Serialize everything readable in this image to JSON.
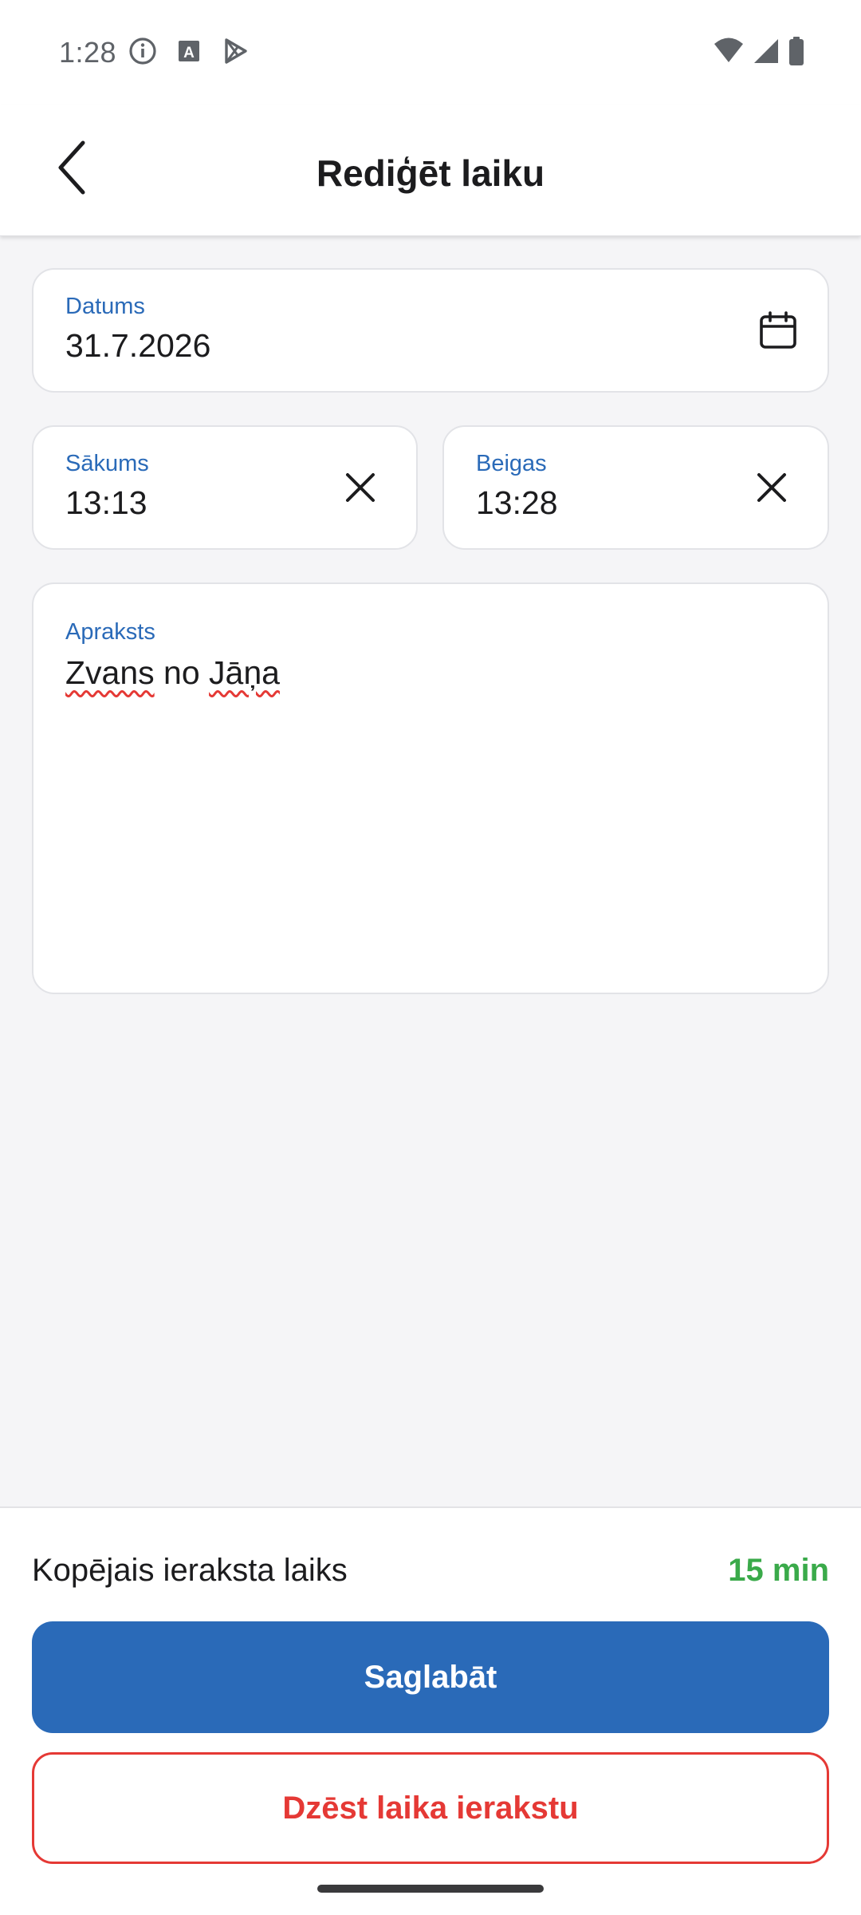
{
  "status_bar": {
    "time": "1:28",
    "left_icons": [
      "info-icon",
      "a-box-icon",
      "play-store-icon"
    ],
    "right_icons": [
      "wifi-icon",
      "signal-icon",
      "battery-icon"
    ]
  },
  "app_bar": {
    "title": "Rediģēt laiku",
    "back_icon": "chevron-left-icon"
  },
  "form": {
    "date": {
      "label": "Datums",
      "value": "31.7.2026",
      "icon": "calendar-icon"
    },
    "start": {
      "label": "Sākums",
      "value": "13:13",
      "clear_icon": "close-icon"
    },
    "end": {
      "label": "Beigas",
      "value": "13:28",
      "clear_icon": "close-icon"
    },
    "description": {
      "label": "Apraksts",
      "value_parts": [
        "Zvans",
        " no ",
        "Jāņa"
      ]
    }
  },
  "summary": {
    "total_label": "Kopējais ieraksta laiks",
    "total_value": "15 min"
  },
  "actions": {
    "save_label": "Saglabāt",
    "delete_label": "Dzēst laika ierakstu"
  },
  "colors": {
    "accent": "#2a6ab8",
    "danger": "#e53935",
    "success": "#3aaa4a",
    "background": "#f5f5f7"
  }
}
